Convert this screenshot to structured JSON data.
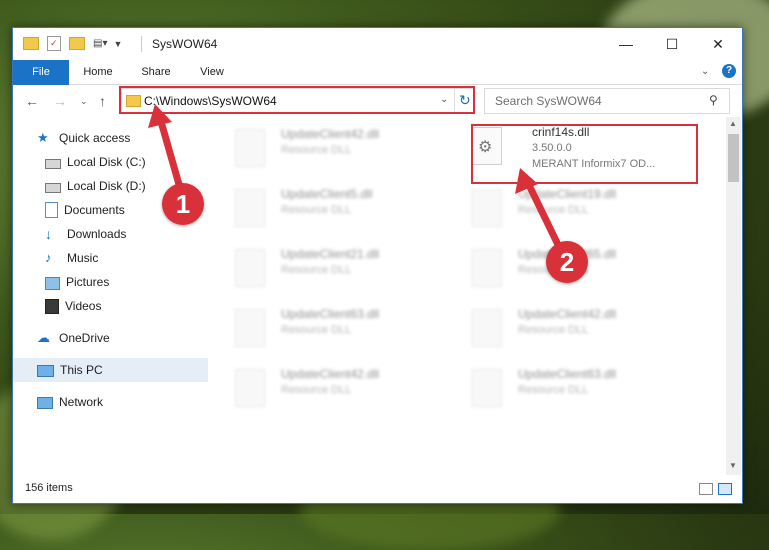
{
  "window": {
    "title": "SysWOW64"
  },
  "ribbon": {
    "tabs": [
      "File",
      "Home",
      "Share",
      "View"
    ]
  },
  "address": {
    "path": "C:\\Windows\\SysWOW64"
  },
  "search": {
    "placeholder": "Search SysWOW64"
  },
  "sidebar": {
    "items": [
      {
        "label": "Quick access",
        "icon": "star-icon",
        "pinned": false
      },
      {
        "label": "Local Disk (C:)",
        "icon": "drive-icon",
        "pinned": true
      },
      {
        "label": "Local Disk (D:)",
        "icon": "drive-icon",
        "pinned": true
      },
      {
        "label": "Documents",
        "icon": "documents-icon",
        "pinned": true
      },
      {
        "label": "Downloads",
        "icon": "download-icon",
        "pinned": true
      },
      {
        "label": "Music",
        "icon": "music-icon",
        "pinned": true
      },
      {
        "label": "Pictures",
        "icon": "pictures-icon",
        "pinned": true
      },
      {
        "label": "Videos",
        "icon": "videos-icon",
        "pinned": true
      },
      {
        "label": "OneDrive",
        "icon": "cloud-icon",
        "pinned": false
      },
      {
        "label": "This PC",
        "icon": "pc-icon",
        "pinned": false,
        "selected": true
      },
      {
        "label": "Network",
        "icon": "network-icon",
        "pinned": false
      }
    ]
  },
  "files": {
    "highlighted": {
      "name": "crinf14s.dll",
      "version": "3.50.0.0",
      "description": "MERANT Informix7 OD..."
    },
    "left_column": [
      {
        "name": "UpdateClient42.dll",
        "type": "Resource DLL"
      },
      {
        "name": "UpdateClient5.dll",
        "type": "Resource DLL"
      },
      {
        "name": "UpdateClient21.dll",
        "type": "Resource DLL"
      },
      {
        "name": "UpdateClient63.dll",
        "type": "Resource DLL"
      },
      {
        "name": "UpdateClient42.dll",
        "type": "Resource DLL"
      }
    ],
    "right_column": [
      {
        "name": "UpdateClient19.dll",
        "type": "Resource DLL"
      },
      {
        "name": "UpdateClient65.dll",
        "type": "Resource DLL"
      },
      {
        "name": "UpdateClient42.dll",
        "type": "Resource DLL"
      },
      {
        "name": "UpdateClient63.dll",
        "type": "Resource DLL"
      }
    ]
  },
  "status": {
    "count": "156 items"
  },
  "annotations": {
    "step1": "1",
    "step2": "2",
    "color": "#d9313a"
  }
}
